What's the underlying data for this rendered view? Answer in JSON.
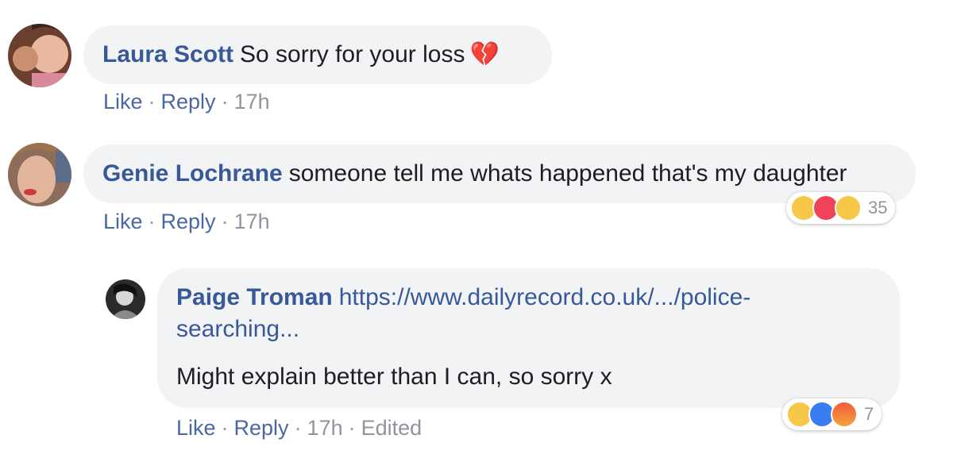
{
  "comments": [
    {
      "author": "Laura Scott",
      "text": "So sorry for your loss",
      "emoji": "💔",
      "actions": {
        "like": "Like",
        "reply": "Reply",
        "time": "17h"
      }
    },
    {
      "author": "Genie Lochrane",
      "text": "someone tell me whats happened that's my daughter",
      "actions": {
        "like": "Like",
        "reply": "Reply",
        "time": "17h"
      },
      "reactions": {
        "icons": [
          "sad-reaction-icon",
          "love-reaction-icon",
          "wow-reaction-icon"
        ],
        "count": "35"
      }
    },
    {
      "author": "Paige Troman",
      "link": "https://www.dailyrecord.co.uk/.../police-searching...",
      "text": "Might explain better than I can, so sorry x",
      "actions": {
        "like": "Like",
        "reply": "Reply",
        "time": "17h",
        "edited": "Edited"
      },
      "reactions": {
        "icons": [
          "sad-reaction-icon",
          "like-reaction-icon",
          "angry-reaction-icon"
        ],
        "count": "7"
      }
    }
  ],
  "colors": {
    "name_link": "#385898",
    "bubble_bg": "#f2f3f5",
    "meta_grey": "#90949c"
  }
}
